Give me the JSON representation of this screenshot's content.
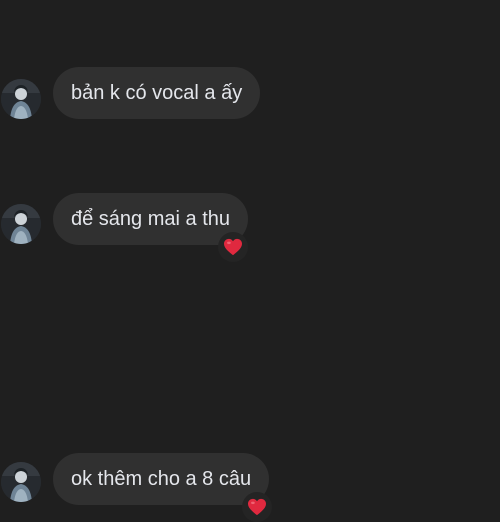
{
  "messages": [
    {
      "text": "bản k có vocal a ấy",
      "reaction": null
    },
    {
      "text": "để sáng mai a thu",
      "reaction": "heart-icon"
    },
    {
      "text": "ok thêm cho a 8 câu",
      "reaction": "heart-icon"
    }
  ],
  "colors": {
    "background": "#1f1f1f",
    "bubble": "#303030",
    "text": "#e4e6eb",
    "reaction": "#e0293f"
  }
}
